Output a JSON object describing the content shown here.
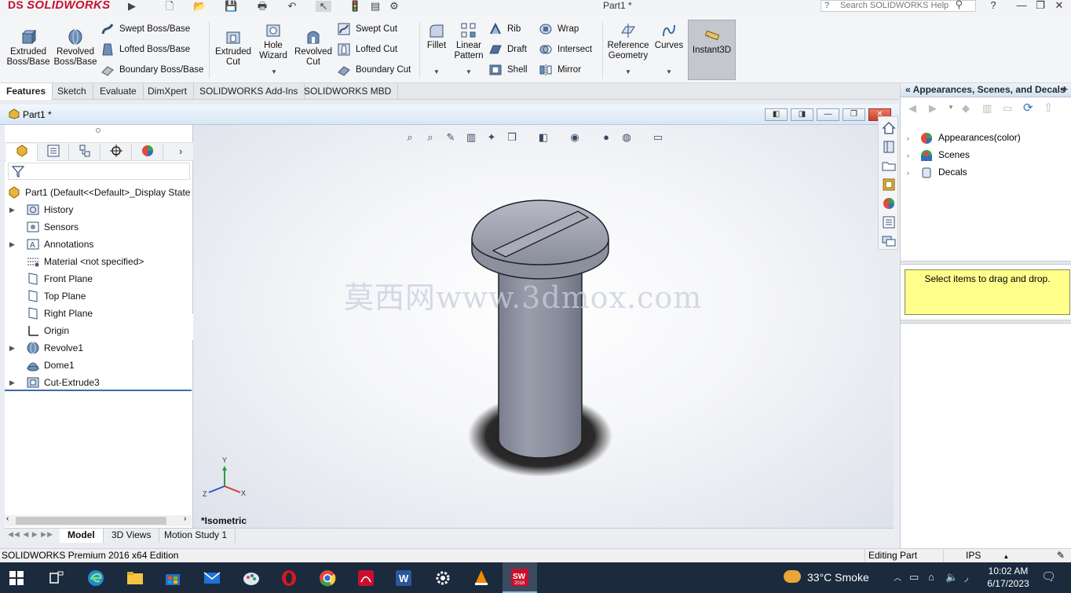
{
  "titlebar": {
    "brand": "SOLIDWORKS",
    "brand_prefix": "DS",
    "document_title": "Part1 *",
    "search_placeholder": "Search SOLIDWORKS Help"
  },
  "ribbon": {
    "extruded_boss": "Extruded Boss/Base",
    "revolved_boss": "Revolved Boss/Base",
    "swept_boss": "Swept Boss/Base",
    "lofted_boss": "Lofted Boss/Base",
    "boundary_boss": "Boundary Boss/Base",
    "extruded_cut": "Extruded Cut",
    "hole_wizard": "Hole Wizard",
    "revolved_cut": "Revolved Cut",
    "swept_cut": "Swept Cut",
    "lofted_cut": "Lofted Cut",
    "boundary_cut": "Boundary Cut",
    "fillet": "Fillet",
    "linear_pattern": "Linear Pattern",
    "rib": "Rib",
    "draft": "Draft",
    "shell": "Shell",
    "wrap": "Wrap",
    "intersect": "Intersect",
    "mirror": "Mirror",
    "reference_geometry": "Reference Geometry",
    "curves": "Curves",
    "instant3d": "Instant3D"
  },
  "tabs": [
    "Features",
    "Sketch",
    "Evaluate",
    "DimXpert",
    "SOLIDWORKS Add-Ins",
    "SOLIDWORKS MBD"
  ],
  "part_header": {
    "label": "Part1 *"
  },
  "feature_tree": {
    "root": "Part1  (Default<<Default>_Display State",
    "items": [
      {
        "label": "History",
        "expandable": true,
        "icon": "history-icon"
      },
      {
        "label": "Sensors",
        "expandable": false,
        "icon": "sensors-icon"
      },
      {
        "label": "Annotations",
        "expandable": true,
        "icon": "annotations-icon"
      },
      {
        "label": "Material <not specified>",
        "expandable": false,
        "icon": "material-icon"
      },
      {
        "label": "Front Plane",
        "expandable": false,
        "icon": "plane-icon"
      },
      {
        "label": "Top Plane",
        "expandable": false,
        "icon": "plane-icon"
      },
      {
        "label": "Right Plane",
        "expandable": false,
        "icon": "plane-icon"
      },
      {
        "label": "Origin",
        "expandable": false,
        "icon": "origin-icon"
      },
      {
        "label": "Revolve1",
        "expandable": true,
        "icon": "revolve-icon"
      },
      {
        "label": "Dome1",
        "expandable": false,
        "icon": "dome-icon"
      },
      {
        "label": "Cut-Extrude3",
        "expandable": true,
        "icon": "cut-extrude-icon"
      }
    ]
  },
  "graphics": {
    "watermark": "莫西网www.3dmox.com",
    "view_label": "*Isometric",
    "triad": {
      "x": "X",
      "y": "Y",
      "z": "Z"
    }
  },
  "bottom_tabs": [
    "Model",
    "3D Views",
    "Motion Study 1"
  ],
  "taskpane": {
    "title": "Appearances, Scenes, and Decals",
    "items": [
      "Appearances(color)",
      "Scenes",
      "Decals"
    ],
    "drop_hint": "Select items to drag and drop."
  },
  "statusbar": {
    "edition": "SOLIDWORKS Premium 2016 x64 Edition",
    "mode": "Editing Part",
    "units": "IPS"
  },
  "taskbar": {
    "weather": "33°C  Smoke",
    "time": "10:02 AM",
    "date": "6/17/2023"
  },
  "colors": {
    "brand_red": "#c8102e",
    "selection_blue": "#3b6ea5",
    "hint_yellow": "#ffff8c",
    "taskbar": "#1b2a3d"
  }
}
